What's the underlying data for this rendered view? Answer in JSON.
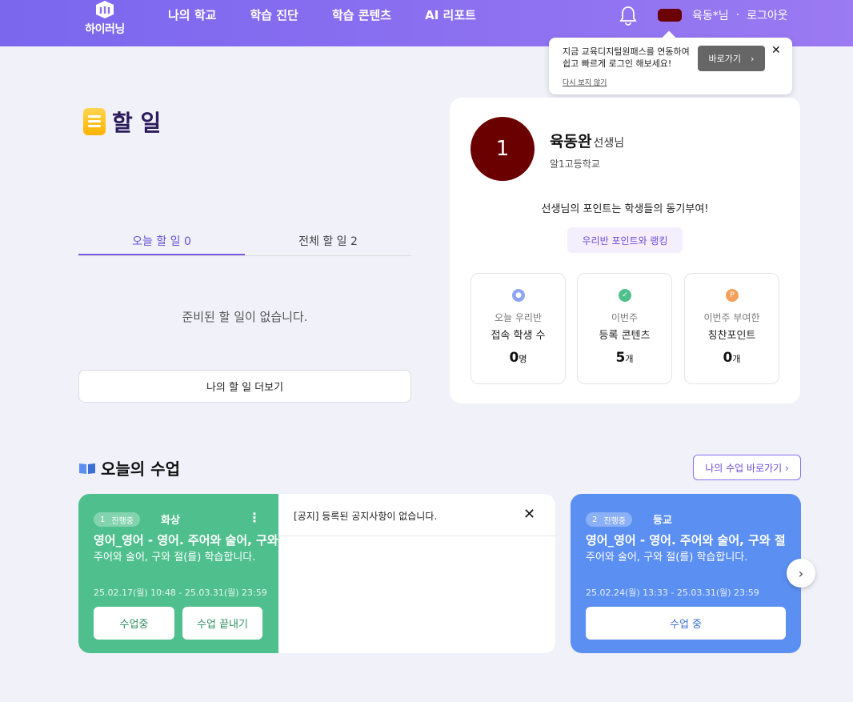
{
  "header": {
    "logo_text": "하이러닝",
    "nav": [
      "나의 학교",
      "학습 진단",
      "학습 콘텐츠",
      "AI 리포트"
    ],
    "user_name": "육동*님",
    "separator": "·",
    "logout": "로그아웃"
  },
  "tooltip": {
    "message": "지금 교육디지털원패스를 연동하여 쉽고 빠르게 로그인 해보세요!",
    "button": "바로가기",
    "button_chevron": "›",
    "close": "✕",
    "dismiss_link": "다시 보지 않기"
  },
  "todo": {
    "title": "할 일",
    "tabs": [
      {
        "label": "오늘 할 일 0",
        "active": true
      },
      {
        "label": "전체 할 일 2",
        "active": false
      }
    ],
    "empty_message": "준비된 할 일이 없습니다.",
    "more_button": "나의 할 일 더보기"
  },
  "profile": {
    "avatar_initial": "1",
    "name": "육동완",
    "role": "선생님",
    "school": "알1고등학교",
    "motto": "선생님의 포인트는 학생들의 동기부여!",
    "ranking_button": "우리반 포인트와 랭킹",
    "stats": [
      {
        "icon": "person-icon",
        "color": "#8fa5f3",
        "glyph": "●",
        "line1": "오늘 우리반",
        "line2": "접속 학생 수",
        "value": "0",
        "unit": "명"
      },
      {
        "icon": "check-icon",
        "color": "#4fc08d",
        "glyph": "✓",
        "line1": "이번주",
        "line2": "등록 콘텐츠",
        "value": "5",
        "unit": "개"
      },
      {
        "icon": "point-icon",
        "color": "#f5a05a",
        "glyph": "P",
        "line1": "이번주 부여한",
        "line2": "칭찬포인트",
        "value": "0",
        "unit": "개"
      }
    ]
  },
  "classes": {
    "title": "오늘의 수업",
    "goto_button": "나의 수업 바로가기 ›",
    "cards": [
      {
        "number": "1",
        "status": "진행중",
        "day": "화상",
        "menu": "⋮",
        "title": "영어_영어 - 영어. 주어와 술어, 구와 절",
        "description": "주어와 술어, 구와 절(를) 학습합니다.",
        "dates": "25.02.17(월) 10:48 - 25.03.31(월) 23:59",
        "buttons": [
          "수업중",
          "수업 끝내기"
        ]
      },
      {
        "number": "2",
        "status": "진행중",
        "day": "등교",
        "title": "영어_영어 - 영어. 주어와 술어, 구와 절",
        "description": "주어와 술어, 구와 절(를) 학습합니다.",
        "dates": "25.02.24(월) 13:33 - 25.03.31(월) 23:59",
        "buttons": [
          "수업 중"
        ]
      }
    ],
    "notice": {
      "text": "[공지] 등록된 공지사항이 없습니다.",
      "close": "✕"
    },
    "next_arrow": "›"
  },
  "colors": {
    "header_gradient_start": "#7a67ee",
    "header_gradient_end": "#9b7af2",
    "accent_purple": "#6a4ed8",
    "card_green": "#4fc08d",
    "card_blue": "#5b8ff2",
    "avatar": "#6b0000",
    "background": "#f0f1f9"
  }
}
